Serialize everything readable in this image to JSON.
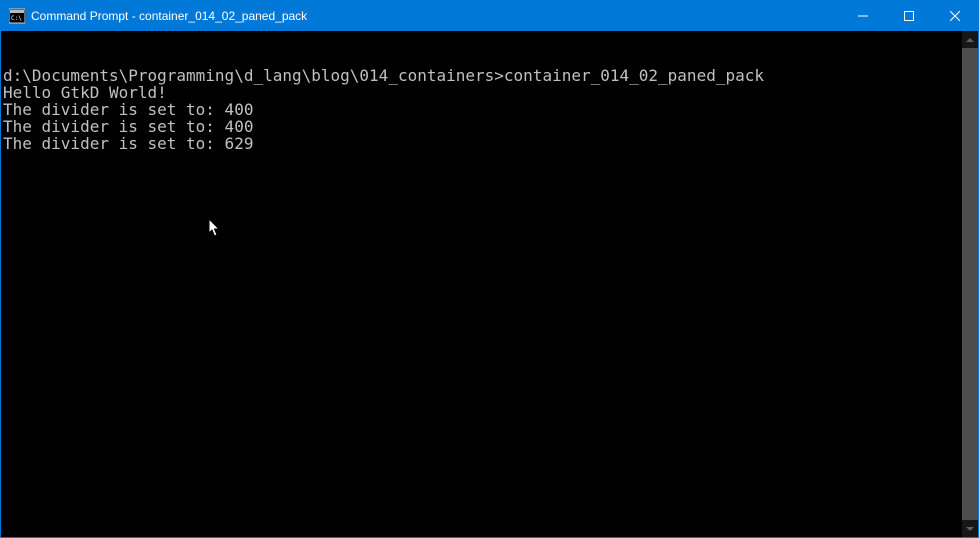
{
  "window": {
    "title": "Command Prompt - container_014_02_paned_pack"
  },
  "console": {
    "prompt": "d:\\Documents\\Programming\\d_lang\\blog\\014_containers>",
    "command": "container_014_02_paned_pack",
    "lines": [
      "Hello GtkD World!",
      "The divider is set to: 400",
      "The divider is set to: 400",
      "The divider is set to: 629"
    ]
  }
}
